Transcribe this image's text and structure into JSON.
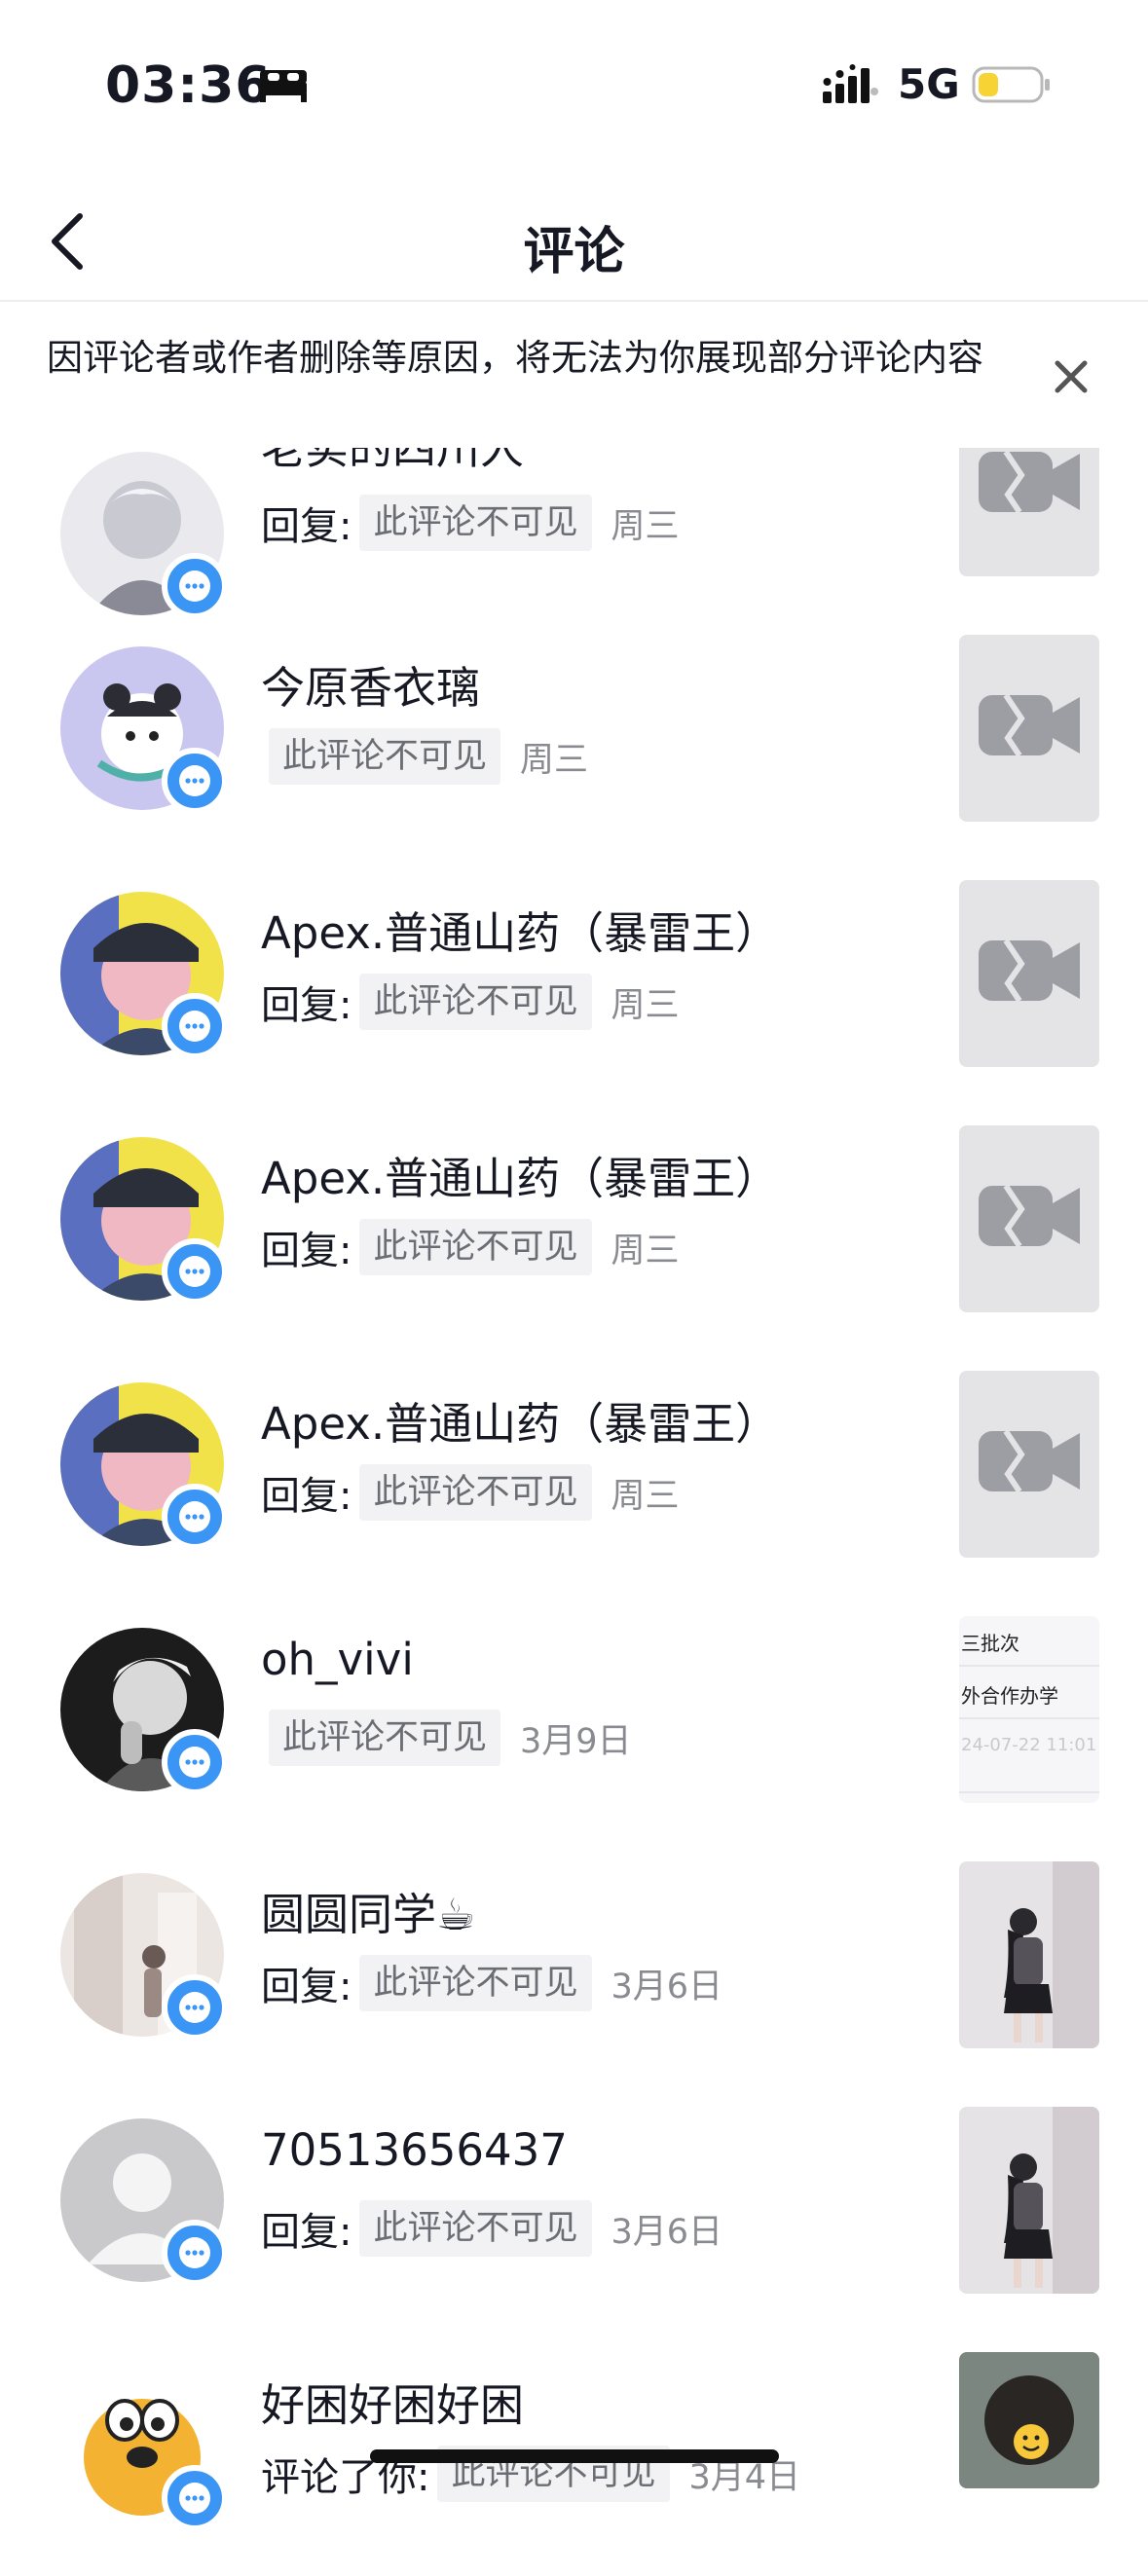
{
  "status_bar": {
    "time": "03:36",
    "network": "5G"
  },
  "header": {
    "title": "评论"
  },
  "notice": {
    "text": "因评论者或作者删除等原因，将无法为你展现部分评论内容"
  },
  "comments": [
    {
      "user": "老实的四川人",
      "prefix": "回复:",
      "text": "此评论不可见",
      "time": "周三"
    },
    {
      "user": "今原香衣璃",
      "prefix": "",
      "text": "此评论不可见",
      "time": "周三"
    },
    {
      "user": "Apex.普通山药（暴雷王）",
      "prefix": "回复:",
      "text": "此评论不可见",
      "time": "周三"
    },
    {
      "user": "Apex.普通山药（暴雷王）",
      "prefix": "回复:",
      "text": "此评论不可见",
      "time": "周三"
    },
    {
      "user": "Apex.普通山药（暴雷王）",
      "prefix": "回复:",
      "text": "此评论不可见",
      "time": "周三"
    },
    {
      "user": "oh_vivi",
      "prefix": "",
      "text": "此评论不可见",
      "time": "3月9日"
    },
    {
      "user": "圆圆同学☕",
      "prefix": "回复:",
      "text": "此评论不可见",
      "time": "3月6日"
    },
    {
      "user": "70513656437",
      "prefix": "回复:",
      "text": "此评论不可见",
      "time": "3月6日"
    },
    {
      "user": "好困好困好困",
      "prefix": "评论了你:",
      "text": "此评论不可见",
      "time": "3月4日"
    }
  ],
  "doc_thumb": {
    "line1": "三批次",
    "line2": "外合作办学",
    "line3": "24-07-22 11:01"
  },
  "icons": {
    "back": "chevron-left-icon",
    "close": "close-icon",
    "badge": "chat-bubble-icon",
    "video_placeholder": "video-camera-icon",
    "sleep": "bed-icon"
  },
  "colors": {
    "badge": "#3a95f5",
    "pill_bg": "#f2f2f4",
    "thumb_bg": "#e4e4e7",
    "battery": "#f7d433"
  }
}
